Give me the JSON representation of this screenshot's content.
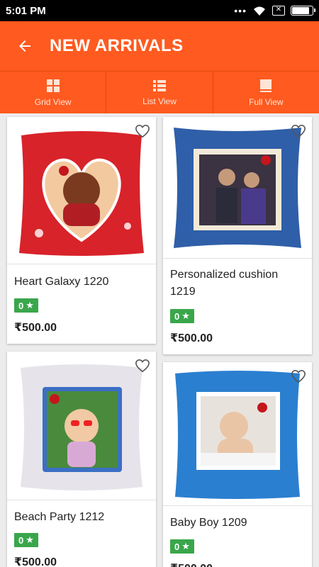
{
  "status_bar": {
    "time": "5:01 PM",
    "dots": "•••"
  },
  "app_bar": {
    "title": "NEW ARRIVALS"
  },
  "tabs": [
    {
      "label": "Grid View",
      "icon": "grid-icon"
    },
    {
      "label": "List View",
      "icon": "list-icon"
    },
    {
      "label": "Full View",
      "icon": "full-view-icon"
    }
  ],
  "products": [
    {
      "title": "Heart Galaxy 1220",
      "rating": "0",
      "price": "₹500.00",
      "theme": "#d8232a"
    },
    {
      "title": "Personalized cushion 1219",
      "rating": "0",
      "price": "₹500.00",
      "theme": "#2f5fa8"
    },
    {
      "title": "Beach Party 1212",
      "rating": "0",
      "price": "₹500.00",
      "theme": "#d9d9de"
    },
    {
      "title": "Baby Boy 1209",
      "rating": "0",
      "price": "₹500.00",
      "theme": "#2b7fd0"
    }
  ],
  "colors": {
    "primary": "#ff5a1f",
    "rating": "#3aa64b"
  }
}
